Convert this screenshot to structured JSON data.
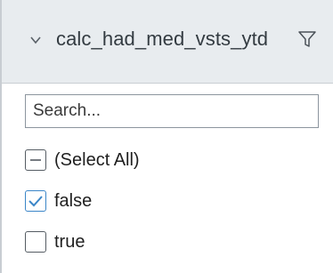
{
  "filter_panel": {
    "field_name": "calc_had_med_vsts_ytd",
    "header_icons": [
      "chevron-down-icon",
      "filter-icon"
    ],
    "search": {
      "placeholder": "Search...",
      "value": ""
    },
    "options": [
      {
        "label": "(Select All)",
        "state": "indeterminate"
      },
      {
        "label": "false",
        "state": "checked"
      },
      {
        "label": "true",
        "state": "unchecked"
      }
    ]
  },
  "colors": {
    "header_bg": "#e8ecef",
    "checkbox_accent": "#3b86c8",
    "text": "#1f1f1f"
  }
}
